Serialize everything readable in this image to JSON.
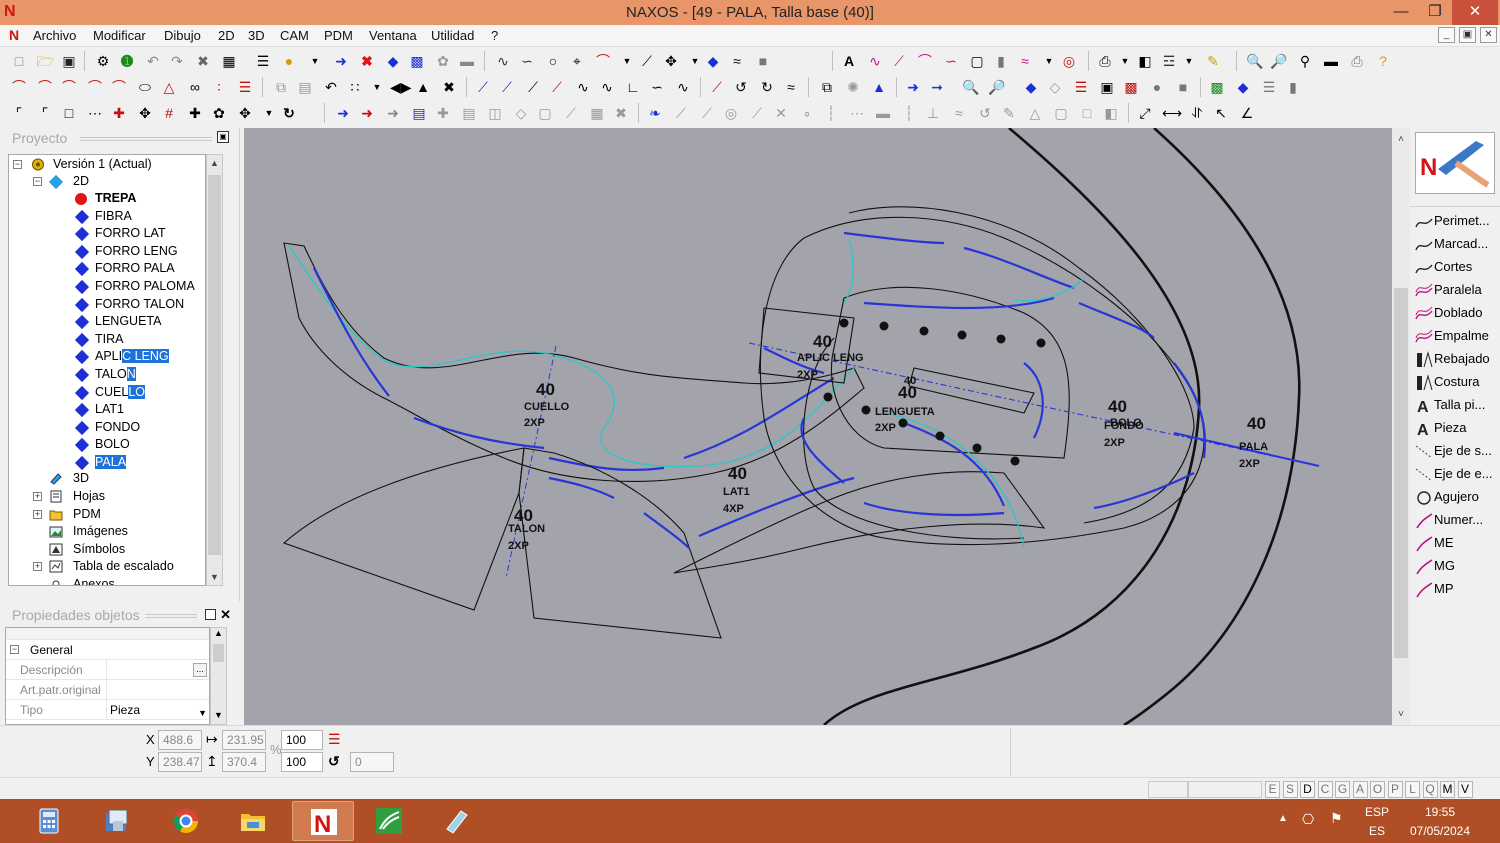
{
  "window": {
    "title": "NAXOS - [49 - PALA, Talla base (40)]",
    "logo": "N",
    "minimize_icon": "—",
    "restore_icon": "❐",
    "close_icon": "✕"
  },
  "menu": {
    "items": [
      "Archivo",
      "Modificar",
      "Dibujo",
      "2D",
      "3D",
      "CAM",
      "PDM",
      "Ventana",
      "Utilidad",
      "?"
    ]
  },
  "project_panel": {
    "title": "Proyecto",
    "tree": {
      "root": "Versión 1 (Actual)",
      "group_2d": "2D",
      "pieces": [
        {
          "label": "TREPA",
          "bold": true,
          "marker": "red-dot"
        },
        {
          "label": "FIBRA"
        },
        {
          "label": "FORRO LAT"
        },
        {
          "label": "FORRO LENG"
        },
        {
          "label": "FORRO PALA"
        },
        {
          "label": "FORRO PALOMA"
        },
        {
          "label": "FORRO TALON"
        },
        {
          "label": "LENGUETA"
        },
        {
          "label": "TIRA"
        },
        {
          "label": "APLIC LENG",
          "highlight_from": 4
        },
        {
          "label": "TALON",
          "highlight_from": 4
        },
        {
          "label": "CUELLO",
          "highlight_from": 4
        },
        {
          "label": "LAT1"
        },
        {
          "label": "FONDO"
        },
        {
          "label": "BOLO"
        },
        {
          "label": "PALA",
          "highlight_from": 0
        }
      ],
      "group_3d": "3D",
      "others": [
        "Hojas",
        "PDM",
        "Imágenes",
        "Símbolos",
        "Tabla de escalado",
        "Anexos"
      ]
    }
  },
  "properties_panel": {
    "title": "Propiedades objetos",
    "section": "General",
    "rows": [
      {
        "label": "Descripción",
        "value": "",
        "has_button": true
      },
      {
        "label": "Art.patr.original",
        "value": ""
      },
      {
        "label": "Tipo",
        "value": "Pieza",
        "dropdown": true
      }
    ]
  },
  "palette": {
    "items": [
      {
        "label": "Perimet...",
        "icon": "curve-icon"
      },
      {
        "label": "Marcad...",
        "icon": "curve-icon"
      },
      {
        "label": "Cortes",
        "icon": "curve-icon"
      },
      {
        "label": "Paralela",
        "icon": "parallel-icon"
      },
      {
        "label": "Doblado",
        "icon": "fold-icon"
      },
      {
        "label": "Empalme",
        "icon": "join-icon"
      },
      {
        "label": "Rebajado",
        "icon": "skive-icon"
      },
      {
        "label": "Costura",
        "icon": "seam-icon"
      },
      {
        "label": "Talla pi...",
        "icon": "text-a-icon"
      },
      {
        "label": "Pieza",
        "icon": "text-a-icon"
      },
      {
        "label": "Eje de s...",
        "icon": "axis-icon"
      },
      {
        "label": "Eje de e...",
        "icon": "axis-icon"
      },
      {
        "label": "Agujero",
        "icon": "hole-icon"
      },
      {
        "label": "Numer...",
        "icon": "pen-icon"
      },
      {
        "label": "ME",
        "icon": "pen-icon"
      },
      {
        "label": "MG",
        "icon": "pen-icon"
      },
      {
        "label": "MP",
        "icon": "pen-icon"
      }
    ]
  },
  "coords": {
    "x_label": "X",
    "y_label": "Y",
    "x": "488.6",
    "y": "238.47",
    "width": "231.95",
    "height": "370.4",
    "scale_x": "100",
    "scale_y": "100",
    "percent": "%",
    "rotation": "0"
  },
  "status_toggles": [
    "E",
    "S",
    "D",
    "C",
    "G",
    "A",
    "O",
    "P",
    "L",
    "Q",
    "M",
    "V"
  ],
  "canvas_labels": {
    "cuello": {
      "size": "40",
      "name": "CUELLO",
      "qty": "2XP"
    },
    "talon": {
      "size": "40",
      "name": "TALON",
      "qty": "2XP"
    },
    "lat1": {
      "size": "40",
      "name": "LAT1",
      "qty": "4XP"
    },
    "aplic": {
      "size": "40",
      "name": "APLIC LENG",
      "qty": "2XP"
    },
    "lengueta": {
      "size": "40",
      "name": "LENGUETA",
      "qty": "2XP",
      "extra": "40"
    },
    "fondo": {
      "size": "40",
      "name": "FONDO",
      "overlap": "BOLO",
      "qty": "2XP"
    },
    "pala": {
      "size": "40",
      "name": "PALA",
      "qty": "2XP"
    }
  },
  "colors": {
    "canvas_bg": "#a3a3ab",
    "outline": "#1a1a1a",
    "seam_blue": "#2a35d8",
    "cyan": "#28c8c8",
    "title_bar": "#e9956a",
    "taskbar": "#b04f26"
  },
  "taskbar": {
    "apps": [
      "calculator-app",
      "file-manager-app",
      "chrome-app",
      "explorer-app",
      "naxos-app",
      "green-app",
      "notes-app"
    ],
    "lang_top": "ESP",
    "lang_bottom": "ES",
    "time": "19:55",
    "date": "07/05/2024"
  }
}
